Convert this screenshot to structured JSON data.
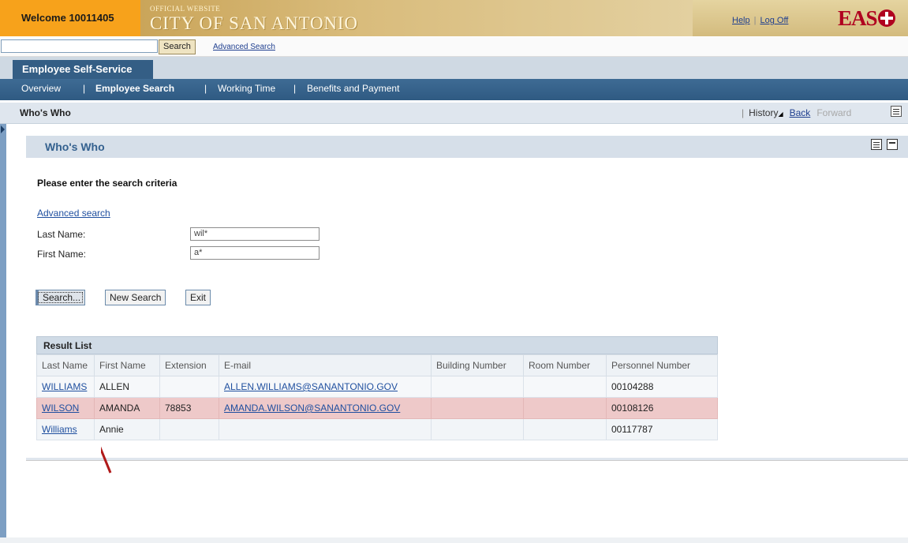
{
  "header": {
    "welcome": "Welcome 10011405",
    "official": "OFFICIAL WEBSITE",
    "city": "CITY OF SAN ANTONIO",
    "help": "Help",
    "logoff": "Log Off",
    "logo": "EAS"
  },
  "search": {
    "value": "",
    "button": "Search",
    "advanced": "Advanced Search"
  },
  "ess_tab": "Employee Self-Service",
  "nav": [
    "Overview",
    "Employee Search",
    "Working Time",
    "Benefits and Payment"
  ],
  "nav_sep": "|",
  "page_title": "Who's Who",
  "history": {
    "sep": "|",
    "history": "History",
    "back": "Back",
    "forward": "Forward"
  },
  "panel": {
    "title": "Who's Who",
    "instruction": "Please enter the search criteria",
    "advanced_link": "Advanced search",
    "last_name_label": "Last Name:",
    "last_name_value": "wil*",
    "first_name_label": "First Name:",
    "first_name_value": "a*",
    "buttons": {
      "search": "Search...",
      "new_search": "New Search",
      "exit": "Exit"
    }
  },
  "results": {
    "title": "Result List",
    "columns": [
      "Last Name",
      "First Name",
      "Extension",
      "E-mail",
      "Building Number",
      "Room Number",
      "Personnel Number"
    ],
    "rows": [
      {
        "last": "WILLIAMS",
        "first": "ALLEN",
        "ext": "",
        "email": "ALLEN.WILLIAMS@SANANTONIO.GOV",
        "building": "",
        "room": "",
        "personnel": "00104288"
      },
      {
        "last": "WILSON",
        "first": "AMANDA",
        "ext": "78853",
        "email": "AMANDA.WILSON@SANANTONIO.GOV",
        "building": "",
        "room": "",
        "personnel": "00108126"
      },
      {
        "last": "Williams",
        "first": "Annie",
        "ext": "",
        "email": "",
        "building": "",
        "room": "",
        "personnel": "00117787"
      }
    ]
  },
  "colors": {
    "accent": "#f7a21b",
    "nav": "#2f5a82",
    "highlight": "#eec9c9",
    "arrow": "#b01a1a"
  }
}
